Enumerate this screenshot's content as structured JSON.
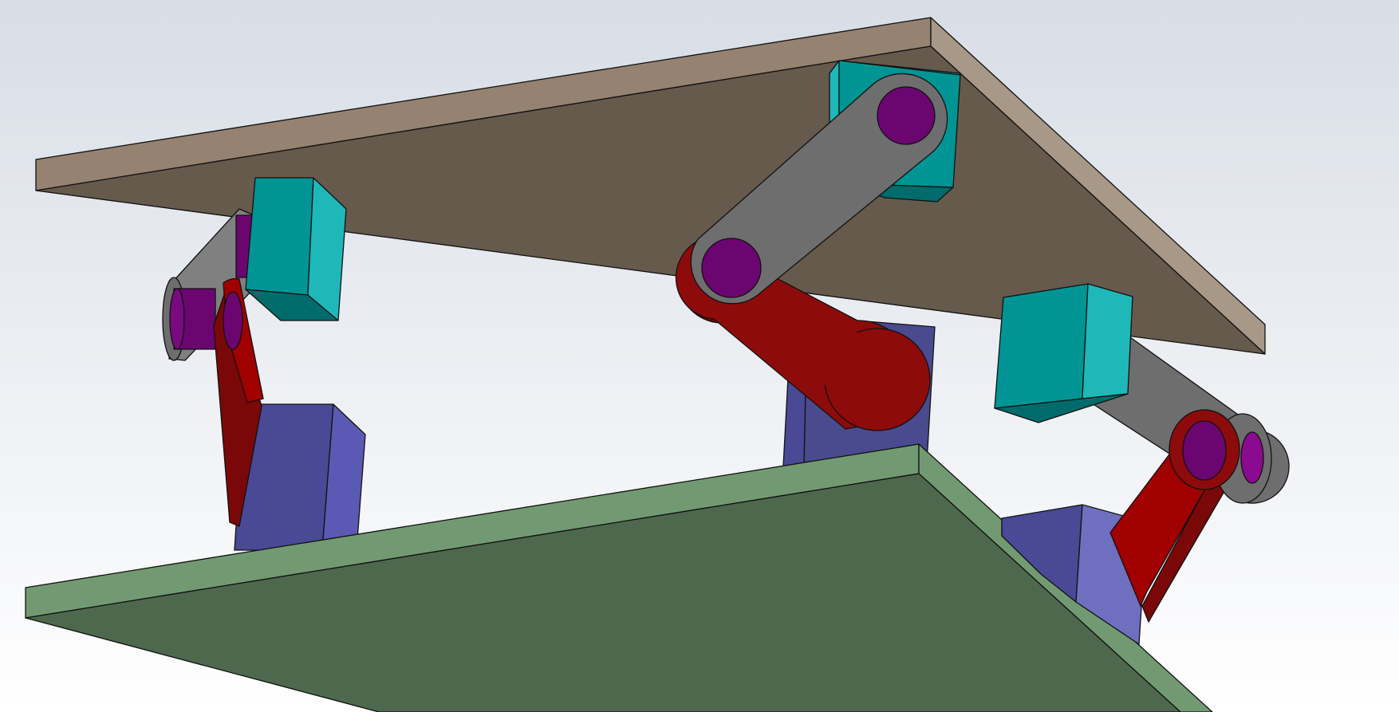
{
  "scene": {
    "kind": "3d-mechanism-render",
    "background_top": "#d8dde6",
    "background_bottom": "#ffffff",
    "colors": {
      "top_plate_underside": "#665a4d",
      "top_plate_edge": "#958271",
      "top_plate_side": "#a89887",
      "bottom_plate_top": "#4e684e",
      "bottom_plate_edge": "#729a72",
      "upper_block": "#009494",
      "upper_block_side": "#1eb8b8",
      "lower_block": "#494996",
      "lower_block_side": "#5a5ab4",
      "gray_link": "#6e6e6e",
      "red_link": "#8e0b0b",
      "pin": "#6b0670"
    },
    "legs": [
      {
        "id": "left",
        "upper_block": "teal",
        "lower_block": "indigo",
        "links": [
          "gray",
          "red"
        ]
      },
      {
        "id": "middle",
        "upper_block": "teal",
        "lower_block": "indigo",
        "links": [
          "gray",
          "red"
        ]
      },
      {
        "id": "right",
        "upper_block": "teal",
        "lower_block": "indigo",
        "links": [
          "gray",
          "red"
        ]
      }
    ]
  }
}
